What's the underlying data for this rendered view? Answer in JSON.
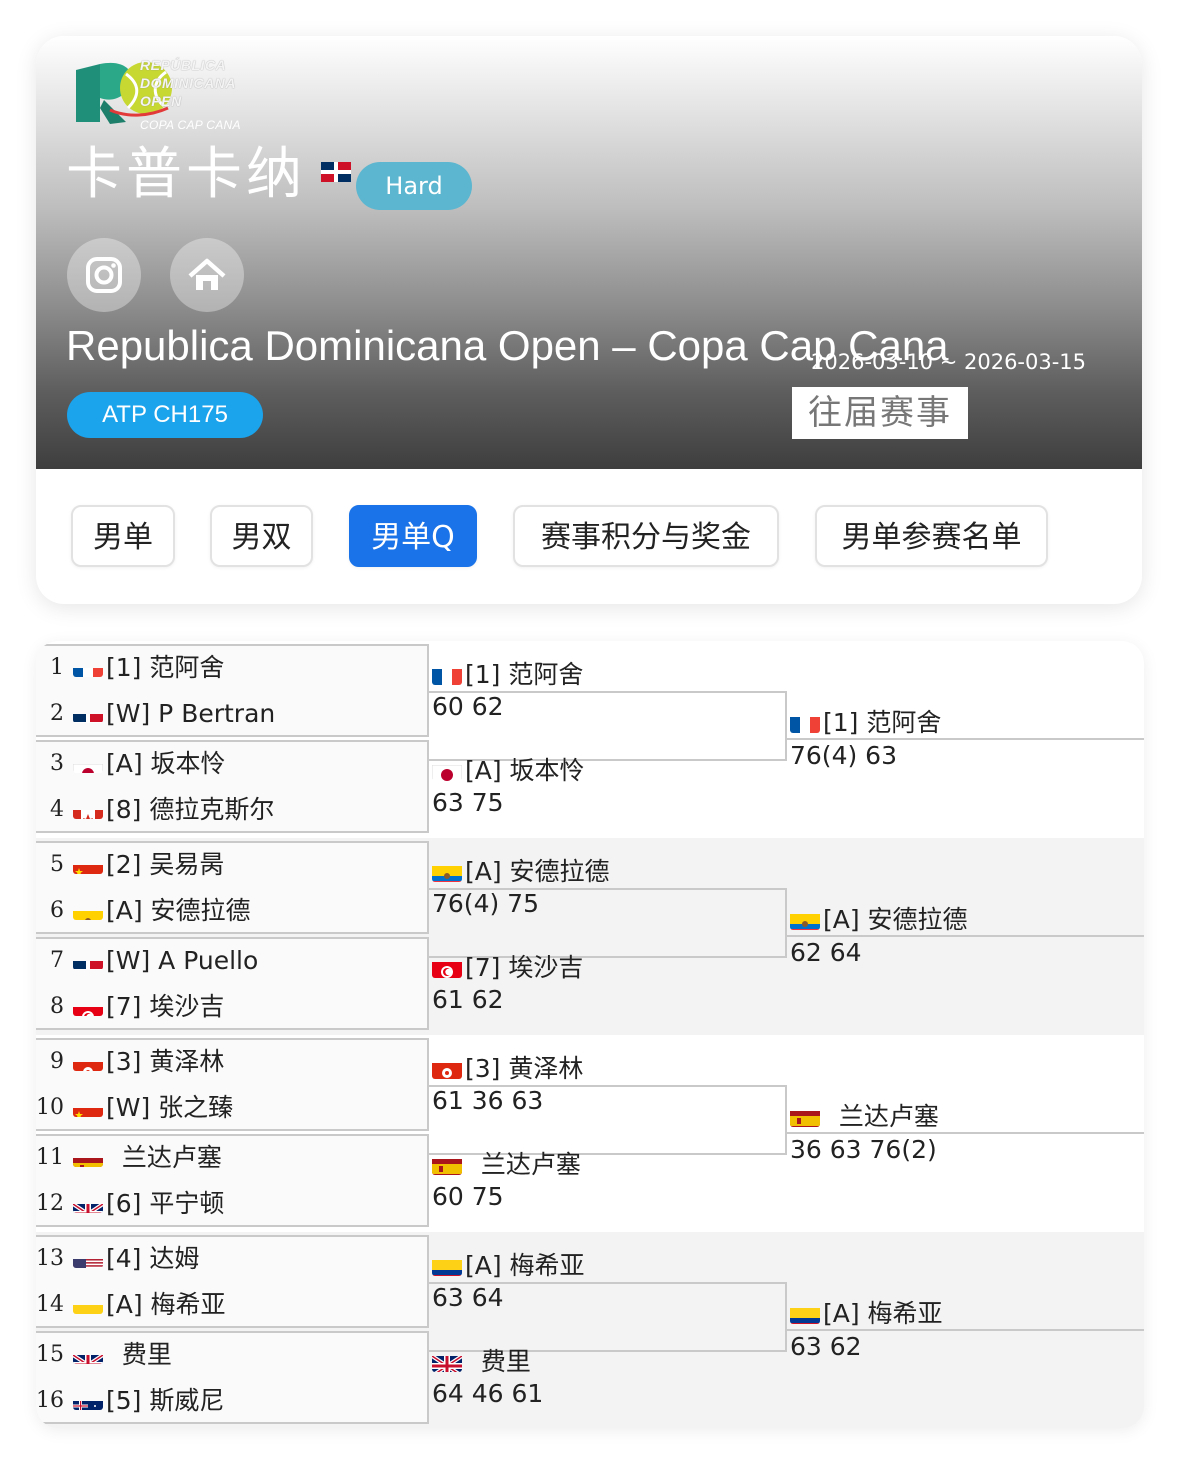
{
  "header": {
    "logo_lines": [
      "REPÚBLICA",
      "DOMINICANA",
      "OPEN"
    ],
    "logo_sub": "COPA CAP CANA",
    "cn_title": "卡普卡纳",
    "surface": "Hard",
    "en_title": "Republica Dominicana Open – Copa Cap Cana",
    "date_range": "2026-03-10 ~ 2026-03-15",
    "category": "ATP CH175",
    "past_events": "往届赛事",
    "icons": [
      "instagram-icon",
      "home-icon"
    ],
    "colors": {
      "surface": "#5cb6cf",
      "category": "#1ba3ec",
      "active_tab": "#1a73e8"
    }
  },
  "tabs": [
    {
      "label": "男单",
      "active": false
    },
    {
      "label": "男双",
      "active": false
    },
    {
      "label": "男单Q",
      "active": true
    },
    {
      "label": "赛事积分与奖金",
      "active": false
    },
    {
      "label": "男单参赛名单",
      "active": false
    }
  ],
  "draw": {
    "round1": [
      {
        "no": "1",
        "flag": "fr",
        "name": "[1] 范阿舍"
      },
      {
        "no": "2",
        "flag": "do",
        "name": "[W] P Bertran"
      },
      {
        "no": "3",
        "flag": "jp",
        "name": "[A] 坂本怜"
      },
      {
        "no": "4",
        "flag": "ca",
        "name": "[8] 德拉克斯尔"
      },
      {
        "no": "5",
        "flag": "cn",
        "name": "[2] 吴易昺"
      },
      {
        "no": "6",
        "flag": "ec",
        "name": "[A] 安德拉德"
      },
      {
        "no": "7",
        "flag": "do",
        "name": "[W] A Puello"
      },
      {
        "no": "8",
        "flag": "tn",
        "name": "[7] 埃沙吉"
      },
      {
        "no": "9",
        "flag": "hk",
        "name": "[3] 黄泽林"
      },
      {
        "no": "10",
        "flag": "cn",
        "name": "[W] 张之臻"
      },
      {
        "no": "11",
        "flag": "es",
        "name": "  兰达卢塞"
      },
      {
        "no": "12",
        "flag": "gb",
        "name": "[6] 平宁顿"
      },
      {
        "no": "13",
        "flag": "us",
        "name": "[4] 达姆"
      },
      {
        "no": "14",
        "flag": "co",
        "name": "[A] 梅希亚"
      },
      {
        "no": "15",
        "flag": "gb",
        "name": "  费里"
      },
      {
        "no": "16",
        "flag": "au",
        "name": "[5] 斯威尼"
      }
    ],
    "round2": [
      {
        "flag": "fr",
        "name": "[1] 范阿舍",
        "score": "60 62"
      },
      {
        "flag": "jp",
        "name": "[A] 坂本怜",
        "score": "63 75"
      },
      {
        "flag": "ec",
        "name": "[A] 安德拉德",
        "score": "76(4) 75"
      },
      {
        "flag": "tn",
        "name": "[7] 埃沙吉",
        "score": "61 62"
      },
      {
        "flag": "hk",
        "name": "[3] 黄泽林",
        "score": "61 36 63"
      },
      {
        "flag": "es",
        "name": "  兰达卢塞",
        "score": "60 75"
      },
      {
        "flag": "co",
        "name": "[A] 梅希亚",
        "score": "63 64"
      },
      {
        "flag": "gb",
        "name": "  费里",
        "score": "64 46 61"
      }
    ],
    "round3": [
      {
        "flag": "fr",
        "name": "[1] 范阿舍",
        "score": "76(4) 63"
      },
      {
        "flag": "ec",
        "name": "[A] 安德拉德",
        "score": "62 64"
      },
      {
        "flag": "es",
        "name": "  兰达卢塞",
        "score": "36 63 76(2)"
      },
      {
        "flag": "co",
        "name": "[A] 梅希亚",
        "score": "63 62"
      }
    ]
  }
}
